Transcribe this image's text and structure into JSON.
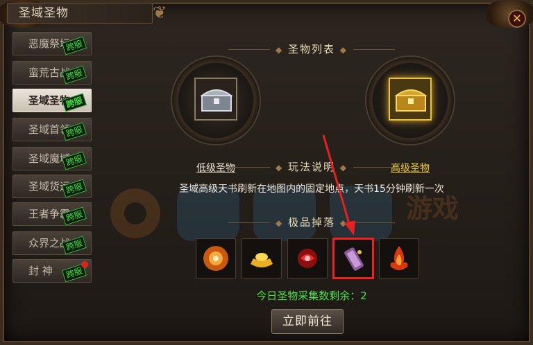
{
  "window": {
    "title": "圣域圣物",
    "close_label": "✕"
  },
  "sidebar": {
    "badge_text": "跨服",
    "items": [
      {
        "label": "恶魔祭坛",
        "active": false
      },
      {
        "label": "蛮荒古战",
        "active": false
      },
      {
        "label": "圣域圣物",
        "active": true
      },
      {
        "label": "圣域首领",
        "active": false
      },
      {
        "label": "圣域魔域",
        "active": false
      },
      {
        "label": "圣域货运",
        "active": false
      },
      {
        "label": "王者争霸",
        "active": false
      },
      {
        "label": "众界之战",
        "active": false
      },
      {
        "label": "封 神",
        "active": false,
        "dot": true
      }
    ]
  },
  "main": {
    "relic_list_title": "圣物列表",
    "low_relic_label": "低级圣物",
    "high_relic_label": "高级圣物",
    "rules_title": "玩法说明",
    "rules_text": "圣域高级天书刷新在地图内的固定地点，天书15分钟刷新一次",
    "drops_title": "极品掉落",
    "drops": [
      "fire-orb-icon",
      "gold-ingot-icon",
      "red-gem-icon",
      "scroll-icon",
      "flame-icon"
    ],
    "highlighted_drop_index": 3,
    "collect_text": "今日圣物采集数剩余：2",
    "go_button": "立即前往"
  },
  "watermark": {
    "text": "游戏"
  },
  "colors": {
    "accent_green": "#4ee24e",
    "highlight_red": "#ee2222",
    "gold": "#f0d040"
  }
}
